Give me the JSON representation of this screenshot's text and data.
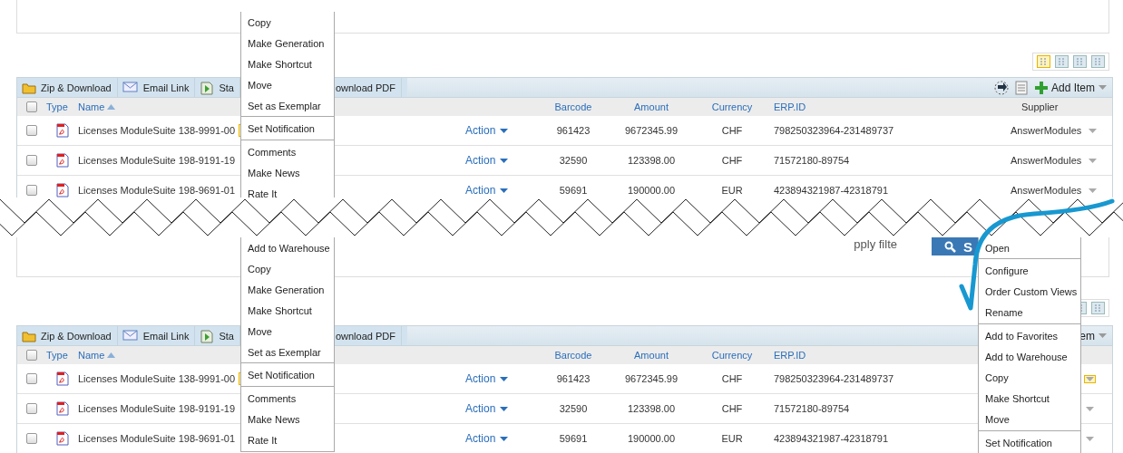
{
  "top": {
    "view_modes": [
      {
        "selected": true
      },
      {
        "selected": false
      },
      {
        "selected": false
      },
      {
        "selected": false
      }
    ],
    "toolbar": {
      "left": [
        {
          "kind": "zip",
          "label": "Zip & Download"
        },
        {
          "kind": "email",
          "label": "Email Link"
        },
        {
          "kind": "workflow",
          "label": "Sta"
        },
        {
          "kind": "none",
          "label": "ownload PDF"
        }
      ],
      "add_item": "Add Item"
    },
    "select_all_checked": false,
    "columns": {
      "type": "Type",
      "name": "Name",
      "barcode": "Barcode",
      "amount": "Amount",
      "currency": "Currency",
      "erp_id": "ERP.ID",
      "supplier": "Supplier"
    },
    "rows": [
      {
        "checked": false,
        "name": "Licenses ModuleSuite 138-9991-00",
        "flagged": true,
        "action": "Action",
        "barcode": "961423",
        "amount": "9672345.99",
        "currency": "CHF",
        "erp_id": "798250323964-231489737",
        "supplier": "AnswerModules",
        "caret_highlighted": false
      },
      {
        "checked": false,
        "name": "Licenses ModuleSuite 198-9191-19",
        "flagged": false,
        "action": "Action",
        "barcode": "32590",
        "amount": "123398.00",
        "currency": "CHF",
        "erp_id": "71572180-89754",
        "supplier": "AnswerModules",
        "caret_highlighted": false
      },
      {
        "checked": false,
        "name": "Licenses ModuleSuite 198-9691-01",
        "flagged": false,
        "action": "Action",
        "barcode": "59691",
        "amount": "190000.00",
        "currency": "EUR",
        "erp_id": "423894321987-42318791",
        "supplier": "AnswerModules",
        "caret_highlighted": false
      }
    ],
    "action_menu": [
      [
        "Copy",
        "Make Generation",
        "Make Shortcut",
        "Move",
        "Set as Exemplar"
      ],
      [
        "Set Notification"
      ],
      [
        "Comments",
        "Make News",
        "Rate It"
      ]
    ]
  },
  "bottom": {
    "filter_text": "pply filte",
    "search_button": "S",
    "view_modes": [
      {
        "selected": false
      },
      {
        "selected": false
      }
    ],
    "toolbar": {
      "left": [
        {
          "kind": "zip",
          "label": "Zip & Download"
        },
        {
          "kind": "email",
          "label": "Email Link"
        },
        {
          "kind": "workflow",
          "label": "Sta"
        },
        {
          "kind": "none",
          "label": "ownload PDF"
        }
      ],
      "add_item": "em"
    },
    "select_all_checked": false,
    "columns": {
      "type": "Type",
      "name": "Name",
      "barcode": "Barcode",
      "amount": "Amount",
      "currency": "Currency",
      "erp_id": "ERP.ID"
    },
    "rows": [
      {
        "checked": false,
        "name": "Licenses ModuleSuite 138-9991-00",
        "flagged": true,
        "action": "Action",
        "barcode": "961423",
        "amount": "9672345.99",
        "currency": "CHF",
        "erp_id": "798250323964-231489737",
        "caret_highlighted": true
      },
      {
        "checked": false,
        "name": "Licenses ModuleSuite 198-9191-19",
        "flagged": false,
        "action": "Action",
        "barcode": "32590",
        "amount": "123398.00",
        "currency": "CHF",
        "erp_id": "71572180-89754",
        "caret_highlighted": false
      },
      {
        "checked": false,
        "name": "Licenses ModuleSuite 198-9691-01",
        "flagged": false,
        "action": "Action",
        "barcode": "59691",
        "amount": "190000.00",
        "currency": "EUR",
        "erp_id": "423894321987-42318791",
        "caret_highlighted": false
      }
    ],
    "action_menu": [
      [
        "Add to Warehouse",
        "Copy",
        "Make Generation",
        "Make Shortcut",
        "Move",
        "Set as Exemplar"
      ],
      [
        "Set Notification"
      ],
      [
        "Comments",
        "Make News",
        "Rate It"
      ]
    ],
    "folder_menu": [
      [
        "Open"
      ],
      [
        "Configure",
        "Order Custom Views",
        "Rename"
      ],
      [
        "Add to Favorites",
        "Add to Warehouse",
        "Copy",
        "Make Shortcut",
        "Move"
      ],
      [
        "Set Notification"
      ]
    ]
  }
}
